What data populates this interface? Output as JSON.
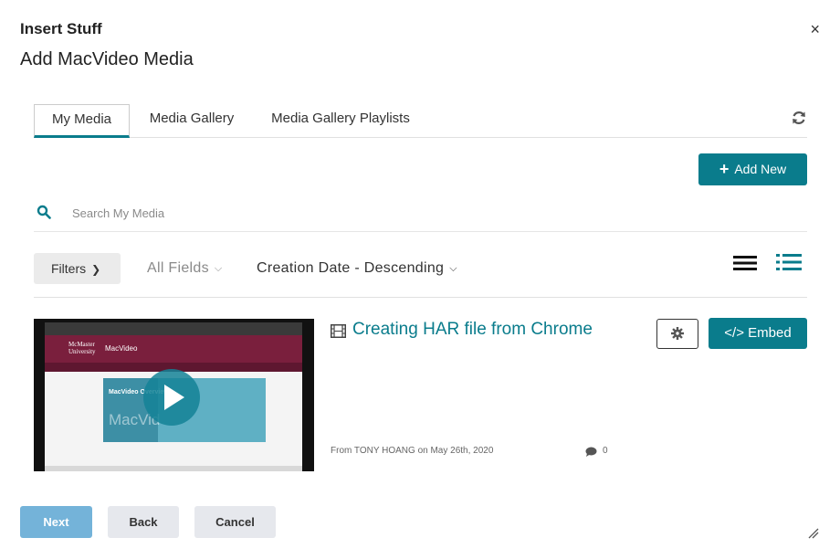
{
  "dialog": {
    "title": "Insert Stuff",
    "subtitle": "Add MacVideo Media",
    "close_label": "×"
  },
  "tabs": [
    {
      "label": "My Media",
      "active": true
    },
    {
      "label": "Media Gallery",
      "active": false
    },
    {
      "label": "Media Gallery Playlists",
      "active": false
    }
  ],
  "toolbar": {
    "add_new_label": "Add New"
  },
  "search": {
    "placeholder": "Search My Media",
    "value": ""
  },
  "filters": {
    "filters_label": "Filters",
    "fields_label": "All Fields",
    "sort_label": "Creation Date - Descending"
  },
  "media_items": [
    {
      "title": "Creating HAR file from Chrome",
      "meta": "From TONY HOANG on May 26th, 2020",
      "comments": "0",
      "embed_label": "</> Embed",
      "thumbnail": {
        "logo_line1": "McMaster",
        "logo_line2": "University",
        "site_name": "MacVideo",
        "promo_title": "MacVideo Overview",
        "promo_faint": "MacVid"
      }
    }
  ],
  "footer": {
    "next_label": "Next",
    "back_label": "Back",
    "cancel_label": "Cancel"
  },
  "colors": {
    "accent": "#0a7c8c",
    "next_button": "#74b3d9",
    "secondary_button": "#e6e8ed"
  }
}
